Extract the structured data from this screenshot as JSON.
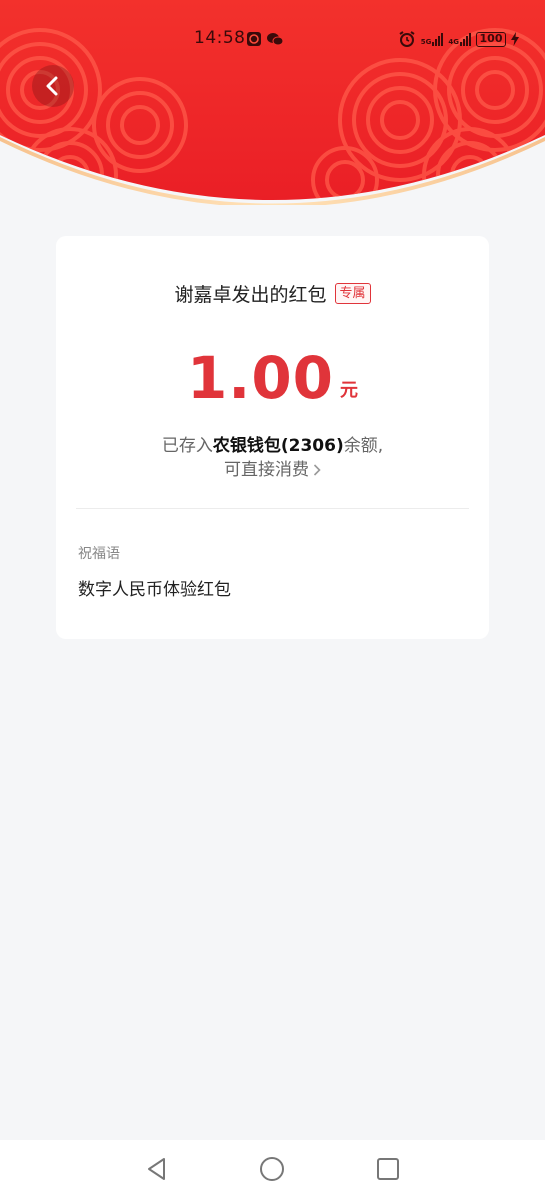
{
  "status_bar": {
    "time": "14:58",
    "network_1": "5G",
    "network_2": "4G",
    "battery": "100"
  },
  "card": {
    "sender_title": "谢嘉卓发出的红包",
    "badge": "专属",
    "amount": "1.00",
    "unit": "元",
    "deposit_prefix": "已存入",
    "wallet_name": "农银钱包(2306)",
    "deposit_suffix": "余额,",
    "spend_link": "可直接消费"
  },
  "blessing": {
    "label": "祝福语",
    "text": "数字人民币体验红包"
  },
  "icons": {
    "back": "chevron-left-icon",
    "nav_back": "triangle-back-icon",
    "nav_home": "circle-home-icon",
    "nav_recents": "square-recents-icon"
  },
  "colors": {
    "header_red": "#f0282a",
    "amount_red": "#e0343a",
    "background": "#f5f6f8"
  }
}
